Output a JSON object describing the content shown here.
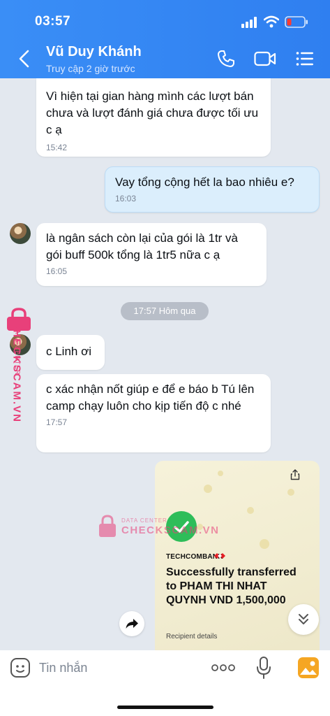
{
  "status_bar": {
    "time": "03:57"
  },
  "header": {
    "contact_name": "Vũ Duy Khánh",
    "contact_status": "Truy cập 2 giờ trước"
  },
  "messages": [
    {
      "direction": "in",
      "text": "Vì hiện tại gian hàng mình các lượt bán chưa và lượt đánh giá chưa được tối ưu c ạ",
      "time": "15:42"
    },
    {
      "direction": "out",
      "text": "Vay tổng cộng hết la bao nhiêu e?",
      "time": "16:03"
    },
    {
      "direction": "in",
      "text": "là ngân sách còn lại của gói là 1tr và gói buff 500k tổng là 1tr5 nữa c ạ",
      "time": "16:05"
    },
    {
      "direction": "in",
      "text": "c Linh ơi",
      "time": ""
    },
    {
      "direction": "in",
      "text": "c xác nhận nốt giúp e để e báo b Tú lên camp chạy luôn cho kịp tiến độ c nhé",
      "time": "17:57"
    }
  ],
  "date_divider": "17:57 Hôm qua",
  "transfer_image": {
    "bank_name": "TECHCOMBANK",
    "title": "Successfully transferred to PHAM THI NHAT QUYNH VND 1,500,000",
    "recipient_label": "Recipient details"
  },
  "watermark": {
    "main": "CHECKSCAM.VN",
    "sub": "DATA CENTER"
  },
  "input_bar": {
    "placeholder": "Tin nhắn"
  },
  "colors": {
    "header": "#3a8ef6",
    "chat_background": "#e3e8ef",
    "outgoing_bubble": "#dbeefc",
    "watermark": "#e8407a"
  }
}
